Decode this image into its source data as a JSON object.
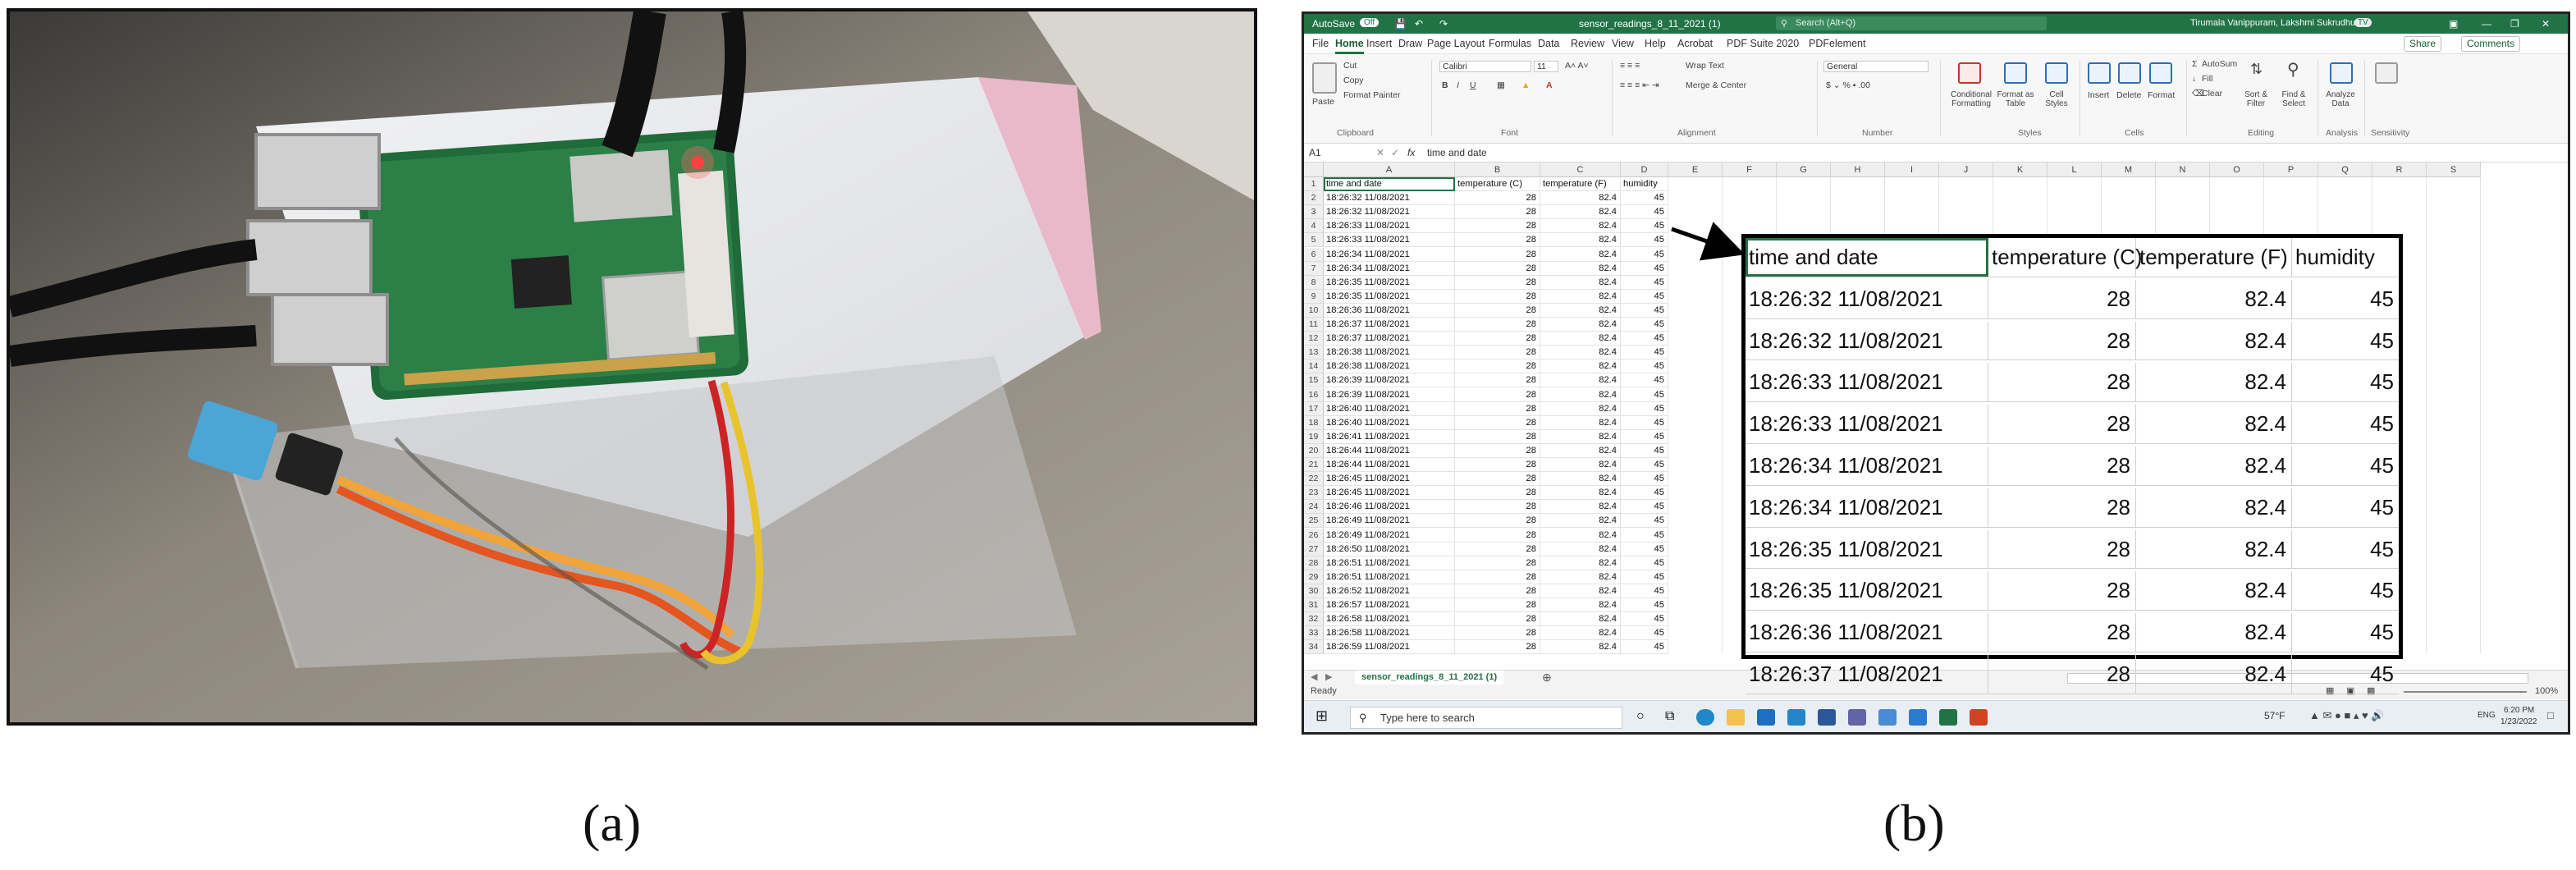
{
  "figure": {
    "label_a": "(a)",
    "label_b": "(b)"
  },
  "excel": {
    "title": {
      "autosave": "AutoSave",
      "autosave_state": "Off",
      "filename": "sensor_readings_8_11_2021 (1)",
      "search": "Search (Alt+Q)",
      "user": "Tirumala Vanippuram, Lakshmi Sukrudhu",
      "user_initials": "TV"
    },
    "tabs": [
      "File",
      "Home",
      "Insert",
      "Draw",
      "Page Layout",
      "Formulas",
      "Data",
      "Review",
      "View",
      "Help",
      "Acrobat",
      "PDF Suite 2020",
      "PDFelement"
    ],
    "active_tab": "Home",
    "share": "Share",
    "comments": "Comments",
    "ribbon": {
      "paste": "Paste",
      "cut": "Cut",
      "copy": "Copy",
      "format_painter": "Format Painter",
      "clipboard": "Clipboard",
      "font_name": "Calibri",
      "font_size": "11",
      "font": "Font",
      "wrap_text": "Wrap Text",
      "merge_center": "Merge & Center",
      "alignment": "Alignment",
      "number_format": "General",
      "number": "Number",
      "conditional_formatting": "Conditional Formatting",
      "format_as_table": "Format as Table",
      "cell_styles": "Cell Styles",
      "styles": "Styles",
      "insert": "Insert",
      "delete": "Delete",
      "format": "Format",
      "cells": "Cells",
      "autosum": "AutoSum",
      "fill": "Fill",
      "clear": "Clear",
      "sort_filter": "Sort & Filter",
      "find_select": "Find & Select",
      "editing": "Editing",
      "analyze_data": "Analyze Data",
      "analysis": "Analysis",
      "sensitivity": "Sensitivity"
    },
    "formula_bar": {
      "cell_ref": "A1",
      "fx": "fx",
      "content": "time and date"
    },
    "columns": [
      "A",
      "B",
      "C",
      "D",
      "E",
      "F",
      "G",
      "H",
      "I",
      "J",
      "K",
      "L",
      "M",
      "N",
      "O",
      "P",
      "Q",
      "R",
      "S"
    ],
    "header": [
      "time and date",
      "temperature (C)",
      "temperature (F)",
      "humidity"
    ],
    "rows": [
      [
        "18:26:32 11/08/2021",
        "28",
        "82.4",
        "45"
      ],
      [
        "18:26:32 11/08/2021",
        "28",
        "82.4",
        "45"
      ],
      [
        "18:26:33 11/08/2021",
        "28",
        "82.4",
        "45"
      ],
      [
        "18:26:33 11/08/2021",
        "28",
        "82.4",
        "45"
      ],
      [
        "18:26:34 11/08/2021",
        "28",
        "82.4",
        "45"
      ],
      [
        "18:26:34 11/08/2021",
        "28",
        "82.4",
        "45"
      ],
      [
        "18:26:35 11/08/2021",
        "28",
        "82.4",
        "45"
      ],
      [
        "18:26:35 11/08/2021",
        "28",
        "82.4",
        "45"
      ],
      [
        "18:26:36 11/08/2021",
        "28",
        "82.4",
        "45"
      ],
      [
        "18:26:37 11/08/2021",
        "28",
        "82.4",
        "45"
      ],
      [
        "18:26:37 11/08/2021",
        "28",
        "82.4",
        "45"
      ],
      [
        "18:26:38 11/08/2021",
        "28",
        "82.4",
        "45"
      ],
      [
        "18:26:38 11/08/2021",
        "28",
        "82.4",
        "45"
      ],
      [
        "18:26:39 11/08/2021",
        "28",
        "82.4",
        "45"
      ],
      [
        "18:26:39 11/08/2021",
        "28",
        "82.4",
        "45"
      ],
      [
        "18:26:40 11/08/2021",
        "28",
        "82.4",
        "45"
      ],
      [
        "18:26:40 11/08/2021",
        "28",
        "82.4",
        "45"
      ],
      [
        "18:26:41 11/08/2021",
        "28",
        "82.4",
        "45"
      ],
      [
        "18:26:44 11/08/2021",
        "28",
        "82.4",
        "45"
      ],
      [
        "18:26:44 11/08/2021",
        "28",
        "82.4",
        "45"
      ],
      [
        "18:26:45 11/08/2021",
        "28",
        "82.4",
        "45"
      ],
      [
        "18:26:45 11/08/2021",
        "28",
        "82.4",
        "45"
      ],
      [
        "18:26:46 11/08/2021",
        "28",
        "82.4",
        "45"
      ],
      [
        "18:26:49 11/08/2021",
        "28",
        "82.4",
        "45"
      ],
      [
        "18:26:49 11/08/2021",
        "28",
        "82.4",
        "45"
      ],
      [
        "18:26:50 11/08/2021",
        "28",
        "82.4",
        "45"
      ],
      [
        "18:26:51 11/08/2021",
        "28",
        "82.4",
        "45"
      ],
      [
        "18:26:51 11/08/2021",
        "28",
        "82.4",
        "45"
      ],
      [
        "18:26:52 11/08/2021",
        "28",
        "82.4",
        "45"
      ],
      [
        "18:26:57 11/08/2021",
        "28",
        "82.4",
        "45"
      ],
      [
        "18:26:58 11/08/2021",
        "28",
        "82.4",
        "45"
      ],
      [
        "18:26:58 11/08/2021",
        "28",
        "82.4",
        "45"
      ],
      [
        "18:26:59 11/08/2021",
        "28",
        "82.4",
        "45"
      ]
    ],
    "zoom_rows": 10,
    "sheet_tab": "sensor_readings_8_11_2021 (1)",
    "status": {
      "ready": "Ready",
      "zoom": "100%"
    }
  },
  "taskbar": {
    "search_placeholder": "Type here to search",
    "weather": "57°F",
    "language": "ENG",
    "time": "6:20 PM",
    "date": "1/23/2022"
  },
  "colors": {
    "excel_green": "#217346",
    "red_led": "#ff2a2a"
  }
}
